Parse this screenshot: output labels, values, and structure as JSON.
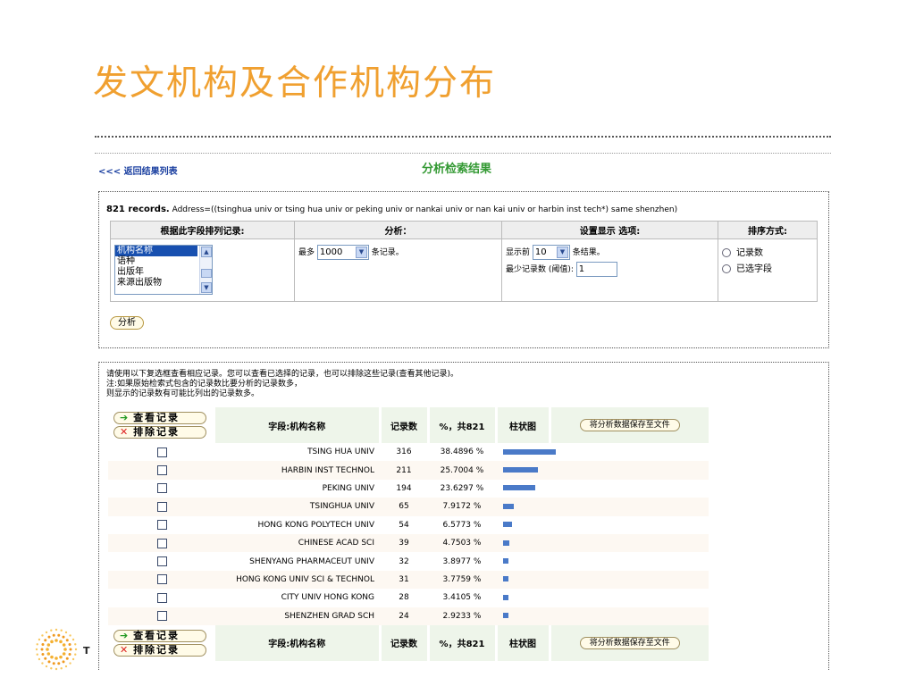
{
  "slide": {
    "title": "发文机构及合作机构分布",
    "footer_letter": "T"
  },
  "nav": {
    "back_link": "<<< 返回结果列表",
    "result_heading": "分析检索结果"
  },
  "query": {
    "records_bold": "821 records.",
    "records_text": "Address=((tsinghua univ or tsing hua univ or peking univ or nankai univ or nan kai univ or harbin inst tech*) same shenzhen)"
  },
  "options": {
    "headers": [
      "根据此字段排列记录:",
      "分析：",
      "设置显示 选项:",
      "排序方式:"
    ],
    "field_list": [
      "机构名称",
      "语种",
      "出版年",
      "来源出版物"
    ],
    "field_selected_index": 0,
    "analyze_prefix": "最多",
    "analyze_value": "1000",
    "analyze_suffix": "条记录。",
    "display_prefix": "显示前",
    "display_value": "10",
    "display_suffix": "条结果。",
    "min_label": "最少记录数 (阈值):",
    "min_value": "1",
    "sort_options": [
      "记录数",
      "已选字段"
    ],
    "analyze_button": "分析"
  },
  "instructions": [
    "请使用以下复选框查看相应记录。您可以查看已选择的记录，也可以排除这些记录(查看其他记录)。",
    "注:如果原始检索式包含的记录数比要分析的记录数多，",
    "则显示的记录数有可能比列出的记录数多。"
  ],
  "results_table": {
    "view_button": "查看记录",
    "exclude_button": "排除记录",
    "col_field": "字段:机构名称",
    "col_count": "记录数",
    "col_pct": "%，共821",
    "col_chart": "柱状图",
    "save_button": "将分析数据保存至文件",
    "rows": [
      {
        "name": "TSING HUA UNIV",
        "count": "316",
        "pct": "38.4896 %",
        "share": 38.4896
      },
      {
        "name": "HARBIN INST TECHNOL",
        "count": "211",
        "pct": "25.7004 %",
        "share": 25.7004
      },
      {
        "name": "PEKING UNIV",
        "count": "194",
        "pct": "23.6297 %",
        "share": 23.6297
      },
      {
        "name": "TSINGHUA UNIV",
        "count": "65",
        "pct": "7.9172 %",
        "share": 7.9172
      },
      {
        "name": "HONG KONG POLYTECH UNIV",
        "count": "54",
        "pct": "6.5773 %",
        "share": 6.5773
      },
      {
        "name": "CHINESE ACAD SCI",
        "count": "39",
        "pct": "4.7503 %",
        "share": 4.7503
      },
      {
        "name": "SHENYANG PHARMACEUT UNIV",
        "count": "32",
        "pct": "3.8977 %",
        "share": 3.8977
      },
      {
        "name": "HONG KONG UNIV SCI & TECHNOL",
        "count": "31",
        "pct": "3.7759 %",
        "share": 3.7759
      },
      {
        "name": "CITY UNIV HONG KONG",
        "count": "28",
        "pct": "3.4105 %",
        "share": 3.4105
      },
      {
        "name": "SHENZHEN GRAD SCH",
        "count": "24",
        "pct": "2.9233 %",
        "share": 2.9233
      }
    ]
  },
  "colors": {
    "title": "#f0a030",
    "heading": "#339933",
    "link": "#1a3fa0",
    "bar": "#4a7ac8"
  }
}
